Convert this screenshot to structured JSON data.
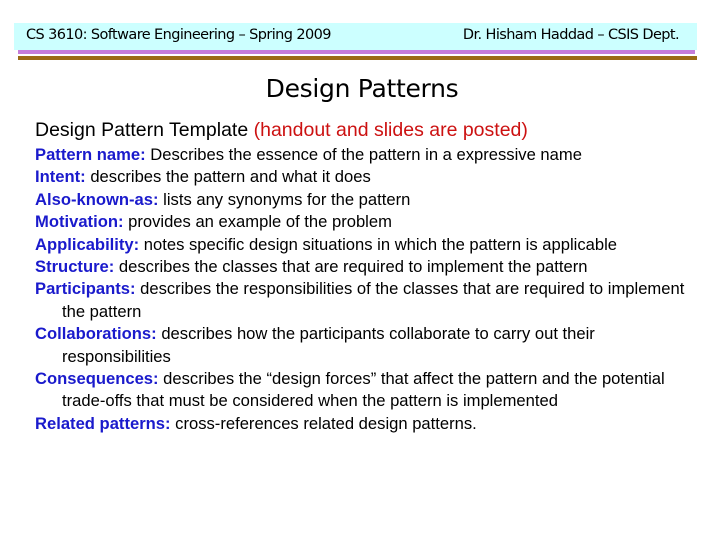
{
  "header": {
    "left": "CS 3610: Software Engineering – Spring 2009",
    "right": "Dr. Hisham Haddad – CSIS Dept."
  },
  "colors": {
    "header_band": "#ccffff",
    "rule_top": "#c47cd9",
    "rule_bottom": "#9a6a14",
    "term": "#1a1acc",
    "note": "#cc1111"
  },
  "title": "Design Patterns",
  "subtitle": {
    "text": "Design Pattern Template ",
    "note": "(handout and slides are posted)"
  },
  "items": [
    {
      "term": "Pattern name:",
      "desc": " Describes the essence of the pattern in a expressive name"
    },
    {
      "term": "Intent:",
      "desc": " describes the pattern and what it does"
    },
    {
      "term": "Also-known-as:",
      "desc": " lists any synonyms for the pattern"
    },
    {
      "term": "Motivation:",
      "desc": " provides an example of the problem"
    },
    {
      "term": "Applicability:",
      "desc": " notes specific design situations in which the pattern is applicable"
    },
    {
      "term": "Structure:",
      "desc": " describes the classes that are required to implement the pattern"
    },
    {
      "term": "Participants:",
      "desc": " describes the responsibilities of the classes that are required to implement the pattern"
    },
    {
      "term": "Collaborations:",
      "desc": " describes how the participants collaborate to carry out their responsibilities"
    },
    {
      "term": "Consequences:",
      "desc": " describes the “design forces” that affect the pattern and the potential trade-offs that must be considered when the pattern is implemented"
    },
    {
      "term": "Related patterns:",
      "desc": " cross-references related design patterns."
    }
  ]
}
